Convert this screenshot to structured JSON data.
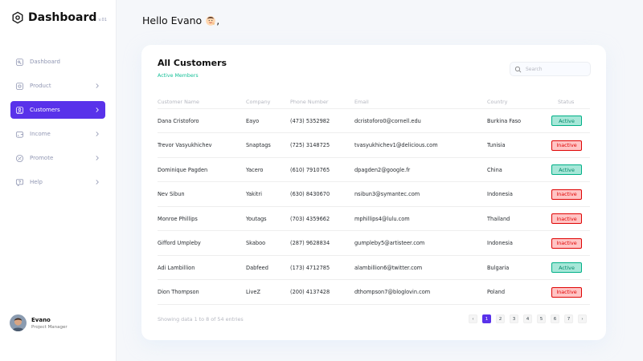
{
  "app": {
    "name": "Dashboard",
    "version": "v.01"
  },
  "colors": {
    "accent": "#5932ea",
    "active": "#00b087",
    "inactive": "#df0404",
    "subtitle": "#16c098"
  },
  "sidebar": {
    "items": [
      {
        "label": "Dashboard",
        "icon": "key-square-icon",
        "chevron": false,
        "active": false
      },
      {
        "label": "Product",
        "icon": "cube-icon",
        "chevron": true,
        "active": false
      },
      {
        "label": "Customers",
        "icon": "user-square-icon",
        "chevron": true,
        "active": true
      },
      {
        "label": "Income",
        "icon": "wallet-icon",
        "chevron": true,
        "active": false
      },
      {
        "label": "Promote",
        "icon": "discount-shape-icon",
        "chevron": true,
        "active": false
      },
      {
        "label": "Help",
        "icon": "message-question-icon",
        "chevron": true,
        "active": false
      }
    ]
  },
  "profile": {
    "name": "Evano",
    "role": "Project Manager"
  },
  "greeting": {
    "text": "Hello Evano",
    "emoji_icon": "waving-hand-emoji-icon",
    "suffix": ","
  },
  "card": {
    "title": "All Customers",
    "subtitle": "Active Members",
    "search_placeholder": "Search",
    "columns": [
      "Customer Name",
      "Company",
      "Phone Number",
      "Email",
      "Country",
      "Status"
    ],
    "rows": [
      {
        "name": "Dana Cristoforo",
        "company": "Eayo",
        "phone": "(473) 5352982",
        "email": "dcristoforo0@cornell.edu",
        "country": "Burkina Faso",
        "status": "Active"
      },
      {
        "name": "Trevor Vasyukhichev",
        "company": "Snaptags",
        "phone": "(725) 3148725",
        "email": "tvasyukhichev1@delicious.com",
        "country": "Tunisia",
        "status": "Inactive"
      },
      {
        "name": "Dominique Pagden",
        "company": "Yacero",
        "phone": "(610) 7910765",
        "email": "dpagden2@google.fr",
        "country": "China",
        "status": "Active"
      },
      {
        "name": "Nev Sibun",
        "company": "Yakitri",
        "phone": "(630) 8430670",
        "email": "nsibun3@symantec.com",
        "country": "Indonesia",
        "status": "Inactive"
      },
      {
        "name": "Monroe Phillips",
        "company": "Youtags",
        "phone": "(703) 4359662",
        "email": "mphillips4@lulu.com",
        "country": "Thailand",
        "status": "Inactive"
      },
      {
        "name": "Gifford Umpleby",
        "company": "Skaboo",
        "phone": "(287) 9628834",
        "email": "gumpleby5@artisteer.com",
        "country": "Indonesia",
        "status": "Inactive"
      },
      {
        "name": "Adi Lambillion",
        "company": "Dabfeed",
        "phone": "(173) 4712785",
        "email": "alambillion6@twitter.com",
        "country": "Bulgaria",
        "status": "Active"
      },
      {
        "name": "Dion Thompson",
        "company": "LiveZ",
        "phone": "(200) 4137428",
        "email": "dthompson7@bloglovin.com",
        "country": "Poland",
        "status": "Inactive"
      }
    ],
    "footer": "Showing data 1 to 8 of 54 entries",
    "pagination": {
      "prev": "‹",
      "pages": [
        "1",
        "2",
        "3",
        "4",
        "5",
        "6",
        "7"
      ],
      "current": "1",
      "next": "›"
    }
  }
}
